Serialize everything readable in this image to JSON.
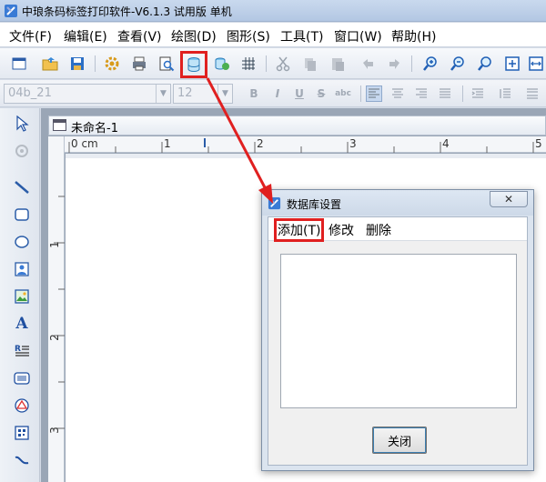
{
  "window": {
    "title": "中琅条码标签打印软件-V6.1.3 试用版 单机"
  },
  "menubar": {
    "items": [
      "文件(F)",
      "编辑(E)",
      "查看(V)",
      "绘图(D)",
      "图形(S)",
      "工具(T)",
      "窗口(W)",
      "帮助(H)"
    ]
  },
  "toolbar": {
    "icons": [
      "new-icon",
      "open-icon",
      "save-icon",
      "settings-icon",
      "print-icon",
      "print-preview-icon",
      "database-icon",
      "data-source-icon",
      "grid-icon",
      "cut-icon",
      "copy-icon",
      "paste-icon",
      "undo-icon",
      "redo-icon",
      "zoom-in-icon",
      "zoom-out-icon",
      "zoom-icon",
      "fit-page-icon",
      "fit-width-icon"
    ],
    "highlighted": "database-icon"
  },
  "format_bar": {
    "font_value": "04b_21",
    "size_value": "12",
    "buttons": [
      "B",
      "I",
      "U",
      "S",
      "abc"
    ]
  },
  "palette": {
    "icons": [
      "select-icon",
      "rotate-icon",
      "line-icon",
      "rounded-rect-icon",
      "ellipse-icon",
      "image-placeholder-icon",
      "picture-icon",
      "text-icon",
      "rich-text-icon",
      "barcode-icon",
      "shape-icon",
      "qrcode-icon",
      "curve-icon"
    ]
  },
  "document": {
    "tab_title": "未命名-1",
    "ruler_unit": "0 cm",
    "h_ticks": [
      "1",
      "2",
      "3",
      "4",
      "5"
    ],
    "v_ticks": [
      "1",
      "2",
      "3"
    ]
  },
  "dialog": {
    "title": "数据库设置",
    "close_glyph": "✕",
    "menu": [
      "添加(T)",
      "修改",
      "删除"
    ],
    "close_button": "关闭"
  },
  "colors": {
    "highlight": "#e02020",
    "menu_bg": "#ffffff",
    "canvas_bg": "#ffffff"
  }
}
